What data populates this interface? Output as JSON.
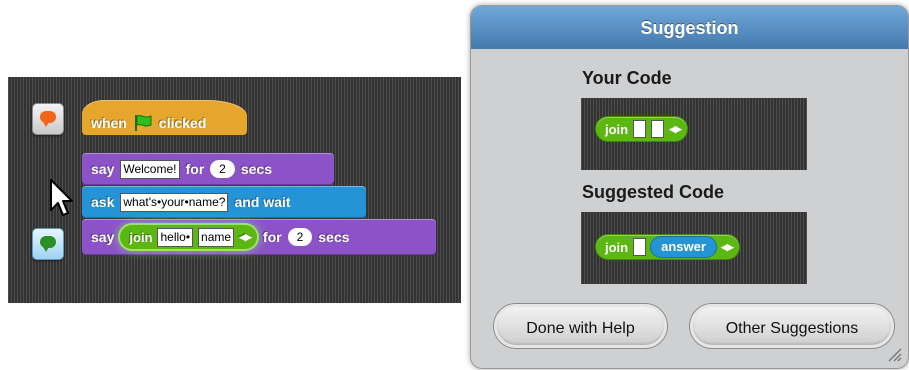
{
  "script": {
    "hat_block": {
      "prefix": "when",
      "suffix": "clicked",
      "icon": "green-flag-icon"
    },
    "say_block_1": {
      "keyword": "say",
      "message": "Welcome!",
      "for_label": "for",
      "seconds": "2",
      "secs_label": "secs"
    },
    "ask_block": {
      "keyword": "ask",
      "prompt": "what's•your•name?",
      "suffix": "and wait"
    },
    "say_block_2": {
      "keyword": "say",
      "join_label": "join",
      "join_arg_1": "hello•",
      "join_arg_2": "name",
      "for_label": "for",
      "seconds": "2",
      "secs_label": "secs"
    },
    "hint_buttons": [
      {
        "icon": "orange-speech-bubble-icon",
        "color": "#f2661a"
      },
      {
        "icon": "green-speech-bubble-icon",
        "color": "#2b8f26",
        "active": true
      }
    ]
  },
  "dialog": {
    "title": "Suggestion",
    "your_code_label": "Your Code",
    "your_code_join": "join",
    "suggested_code_label": "Suggested Code",
    "suggested_code_join": "join",
    "suggested_answer": "answer",
    "done_button": "Done with Help",
    "other_button": "Other Suggestions"
  },
  "colors": {
    "control": "#e6a62c",
    "looks": "#8b53c7",
    "sensing": "#2594d6",
    "operators": "#5cb712",
    "dialog_header": "#4f86bd"
  }
}
